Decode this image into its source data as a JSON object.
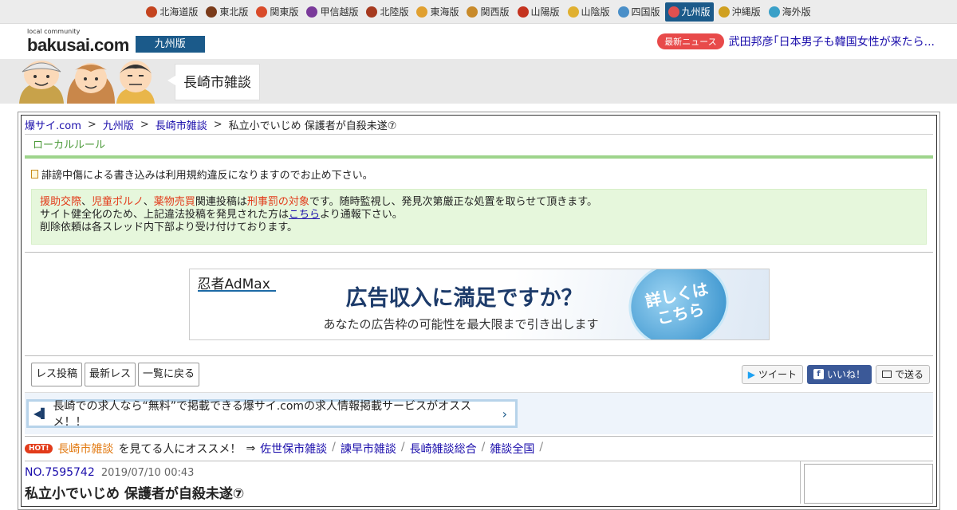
{
  "regions": [
    {
      "label": "北海道版",
      "icon": "hokkaido-icon",
      "color": "#c4441f"
    },
    {
      "label": "東北版",
      "icon": "tohoku-icon",
      "color": "#7a3b1a"
    },
    {
      "label": "関東版",
      "icon": "kanto-icon",
      "color": "#d94b2a"
    },
    {
      "label": "甲信越版",
      "icon": "koshinetsu-icon",
      "color": "#7a3a9a"
    },
    {
      "label": "北陸版",
      "icon": "hokuriku-icon",
      "color": "#a63a1f"
    },
    {
      "label": "東海版",
      "icon": "tokai-icon",
      "color": "#e0a030"
    },
    {
      "label": "関西版",
      "icon": "kansai-icon",
      "color": "#c88a2a"
    },
    {
      "label": "山陽版",
      "icon": "sanyo-icon",
      "color": "#c4331f"
    },
    {
      "label": "山陰版",
      "icon": "sanin-icon",
      "color": "#e0b030"
    },
    {
      "label": "四国版",
      "icon": "shikoku-icon",
      "color": "#4a8fc8"
    },
    {
      "label": "九州版",
      "icon": "kyushu-icon",
      "color": "#e05050",
      "active": true
    },
    {
      "label": "沖縄版",
      "icon": "okinawa-icon",
      "color": "#d0a020"
    },
    {
      "label": "海外版",
      "icon": "overseas-icon",
      "color": "#3aa0c8"
    }
  ],
  "header": {
    "logo_sub": "local community",
    "logo_main": "bakusai.com",
    "edition": "九州版",
    "news_badge": "最新ニュース",
    "news_text": "武田邦彦｢日本男子も韓国女性が来たら..."
  },
  "board": {
    "name": "長崎市雑談"
  },
  "breadcrumb": {
    "home": "爆サイ.com",
    "edition": "九州版",
    "board": "長崎市雑談",
    "thread": "私立小でいじめ 保護者が自殺未遂⑦",
    "sep": ">"
  },
  "rules": {
    "title": "ローカルルール",
    "note": "誹謗中傷による書き込みは利用規約違反になりますのでお止め下さい。",
    "warn1_a": "援助交際",
    "warn1_sep1": "、",
    "warn1_b": "児童ポルノ",
    "warn1_sep2": "、",
    "warn1_c": "薬物売買",
    "warn1_mid": "関連投稿は",
    "warn1_d": "刑事罰の対象",
    "warn1_end": "です。随時監視し、発見次第厳正な処置を取らせて頂きます。",
    "warn2_a": "サイト健全化のため、上記違法投稿を発見された方は",
    "warn2_link": "こちら",
    "warn2_b": "より通報下さい。",
    "warn3": "削除依頼は各スレッド内下部より受け付けております。"
  },
  "ad": {
    "brand": "忍者AdMax",
    "headline": "広告収入に満足ですか？",
    "sub": "あなたの広告枠の可能性を最大限まで引き出します",
    "cta_line1": "詳しくは",
    "cta_line2": "こちら"
  },
  "actions": {
    "post": "レス投稿",
    "latest": "最新レス",
    "back": "一覧に戻る",
    "tweet": "ツイート",
    "like": "いいね！",
    "send": "で送る"
  },
  "job": {
    "text": "長崎での求人なら“無料”で掲載できる爆サイ.comの求人情報掲載サービスがオススメ！！"
  },
  "recommend": {
    "hot": "HOT!",
    "board": "長崎市雑談",
    "lead": "を見てる人にオススメ！",
    "arrow": "⇒",
    "links": [
      "佐世保市雑談",
      "諫早市雑談",
      "長崎雑談総合",
      "雑談全国"
    ],
    "slash": "/"
  },
  "thread": {
    "no": "NO.7595742",
    "date": "2019/07/10 00:43",
    "title": "私立小でいじめ 保護者が自殺未遂⑦"
  }
}
